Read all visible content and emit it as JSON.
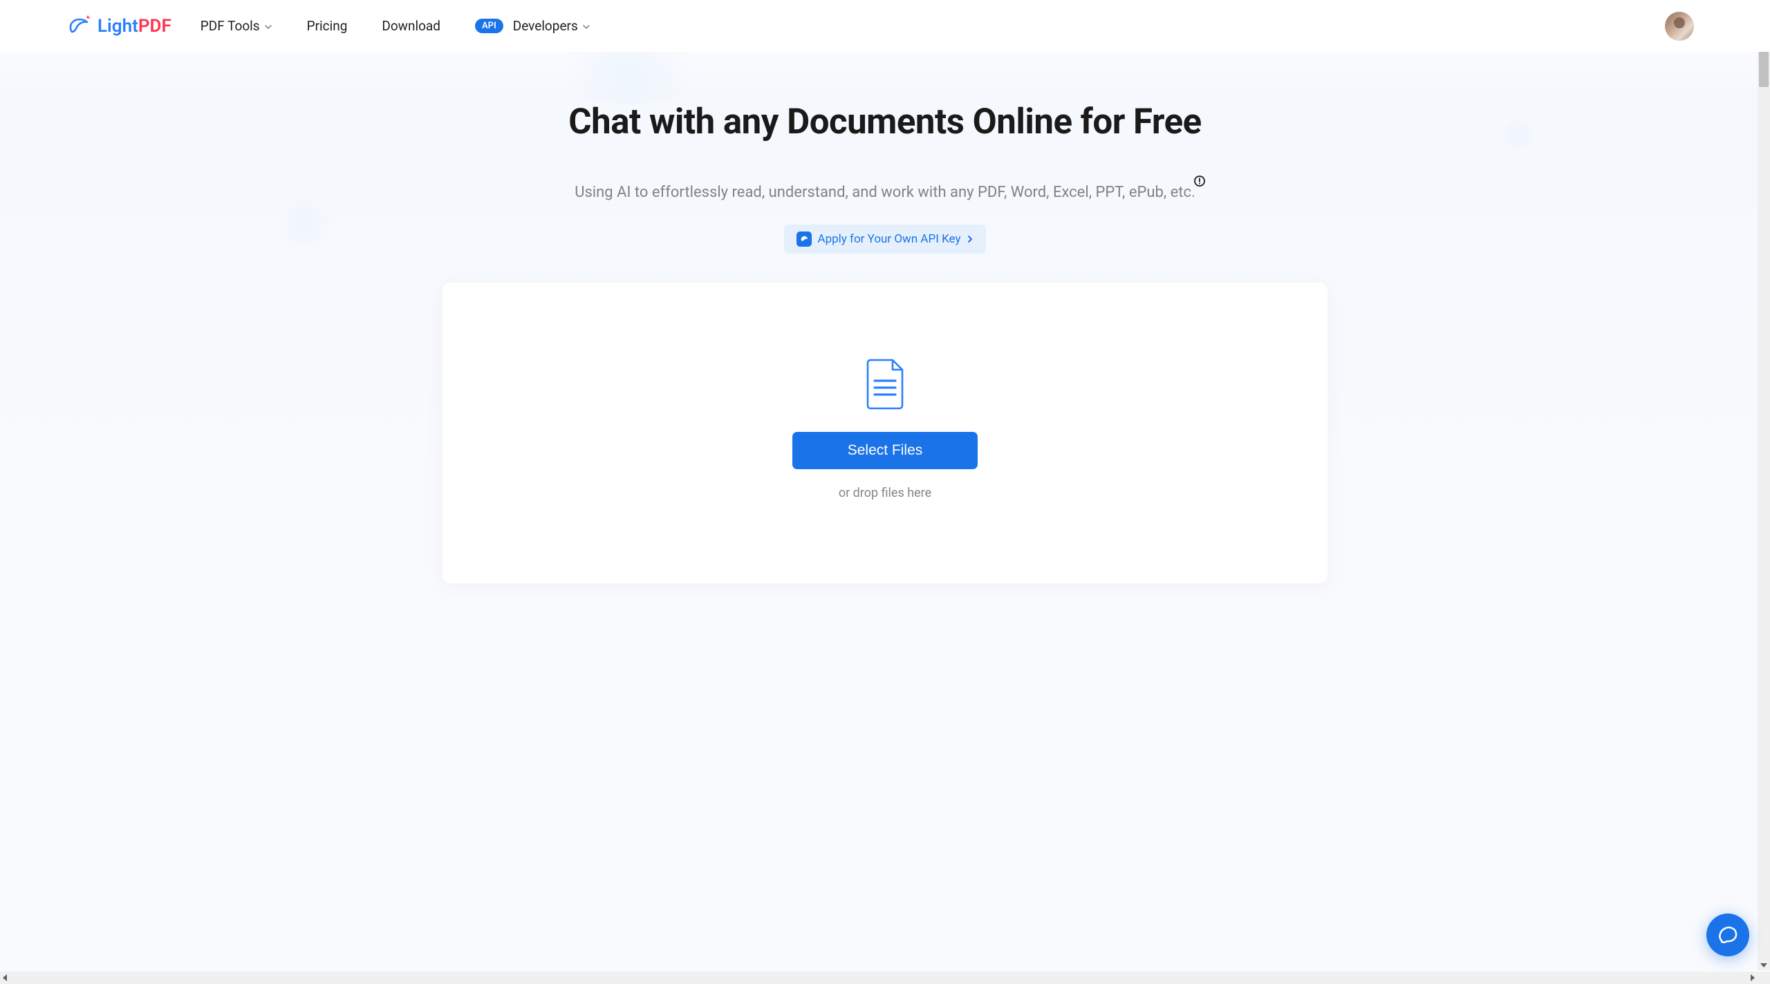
{
  "brand": {
    "name_a": "Light",
    "name_b": "PDF"
  },
  "nav": {
    "pdf_tools": "PDF Tools",
    "pricing": "Pricing",
    "download": "Download",
    "developers": "Developers",
    "api_badge": "API"
  },
  "hero": {
    "title": "Chat with any Documents Online for Free",
    "subtitle": "Using AI to effortlessly read, understand, and work with any PDF, Word, Excel, PPT, ePub, etc.",
    "api_link_text": "Apply for Your Own API Key"
  },
  "upload": {
    "button": "Select Files",
    "hint": "or drop files here"
  }
}
